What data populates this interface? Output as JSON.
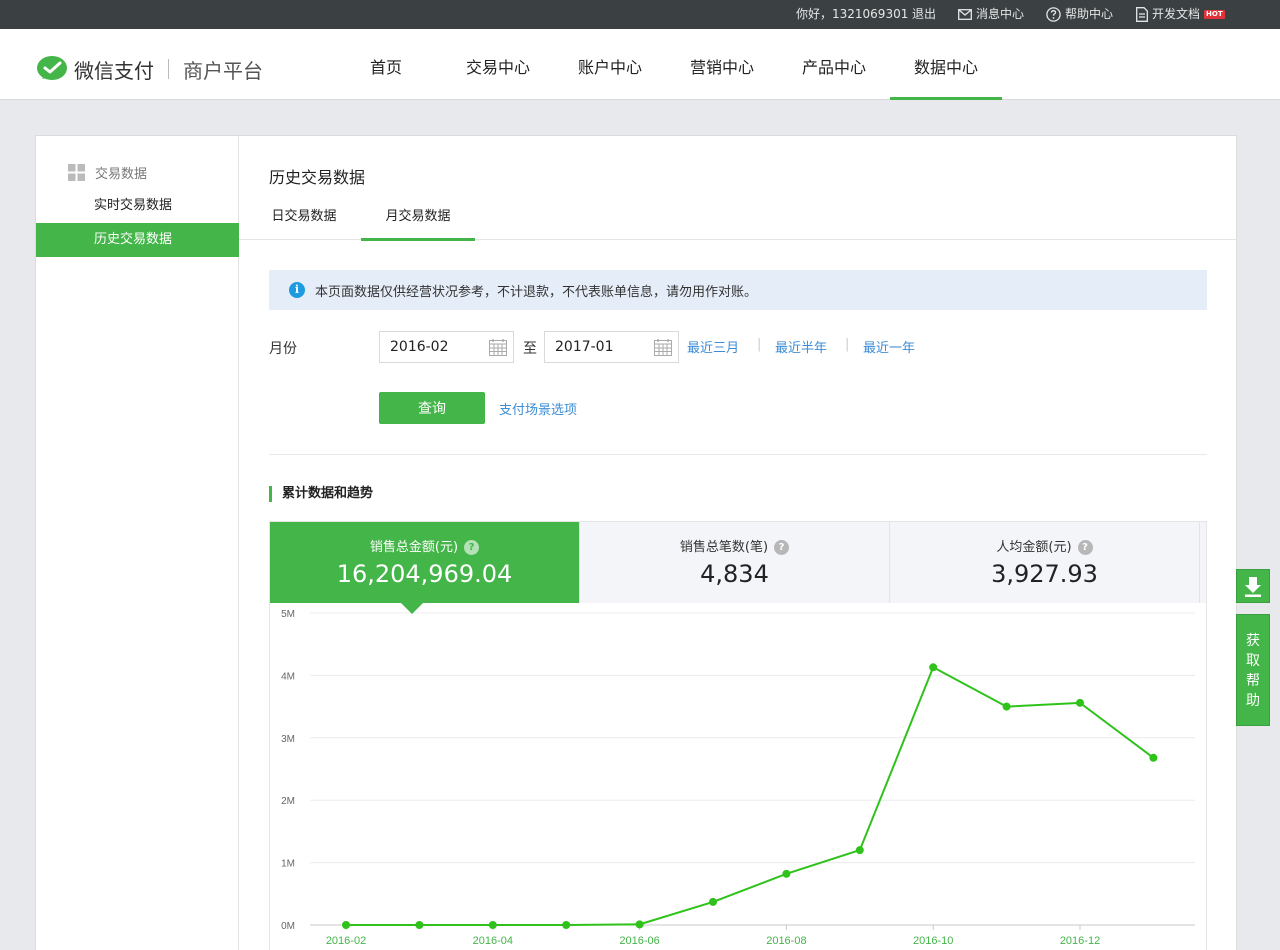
{
  "topbar": {
    "greeting": "你好，1321069301",
    "logout": "退出",
    "messages": "消息中心",
    "help": "帮助中心",
    "docs": "开发文档",
    "hot_badge": "HOT"
  },
  "header": {
    "logo_text": "微信支付",
    "logo_sub": "商户平台",
    "nav": [
      "首页",
      "交易中心",
      "账户中心",
      "营销中心",
      "产品中心",
      "数据中心"
    ],
    "active_nav": "数据中心"
  },
  "sidebar": {
    "group": "交易数据",
    "items": [
      "实时交易数据",
      "历史交易数据"
    ],
    "active": "历史交易数据"
  },
  "content": {
    "page_title": "历史交易数据",
    "tabs": [
      "日交易数据",
      "月交易数据"
    ],
    "active_tab": "月交易数据",
    "notice": "本页面数据仅供经营状况参考，不计退款，不代表账单信息，请勿用作对账。",
    "month_label": "月份",
    "start_month": "2016-02",
    "to_label": "至",
    "end_month": "2017-01",
    "quick_ranges": [
      "最近三月",
      "最近半年",
      "最近一年"
    ],
    "query_button": "查询",
    "scene_link": "支付场景选项",
    "section_title": "累计数据和趋势"
  },
  "stats": [
    {
      "label": "销售总金额(元)",
      "value": "16,204,969.04",
      "active": true
    },
    {
      "label": "销售总笔数(笔)",
      "value": "4,834",
      "active": false
    },
    {
      "label": "人均金额(元)",
      "value": "3,927.93",
      "active": false
    }
  ],
  "float": {
    "help_chars": [
      "获",
      "取",
      "帮",
      "助"
    ]
  },
  "colors": {
    "accent": "#44b549",
    "link": "#3c8dd4",
    "line": "#2ec21a"
  },
  "chart_data": {
    "type": "line",
    "x": [
      "2016-02",
      "2016-03",
      "2016-04",
      "2016-05",
      "2016-06",
      "2016-07",
      "2016-08",
      "2016-09",
      "2016-10",
      "2016-11",
      "2016-12",
      "2017-01"
    ],
    "x_tick_labels": [
      "2016-02",
      "2016-04",
      "2016-06",
      "2016-08",
      "2016-10",
      "2016-12"
    ],
    "series": [
      {
        "values": [
          0,
          0,
          0,
          0,
          10000,
          370000,
          820000,
          1200000,
          4130000,
          3500000,
          3560000,
          2680000
        ]
      }
    ],
    "y_ticks": [
      "0M",
      "1M",
      "2M",
      "3M",
      "4M",
      "5M"
    ],
    "ylim": [
      0,
      5000000
    ],
    "grid": true,
    "legend": "none"
  }
}
